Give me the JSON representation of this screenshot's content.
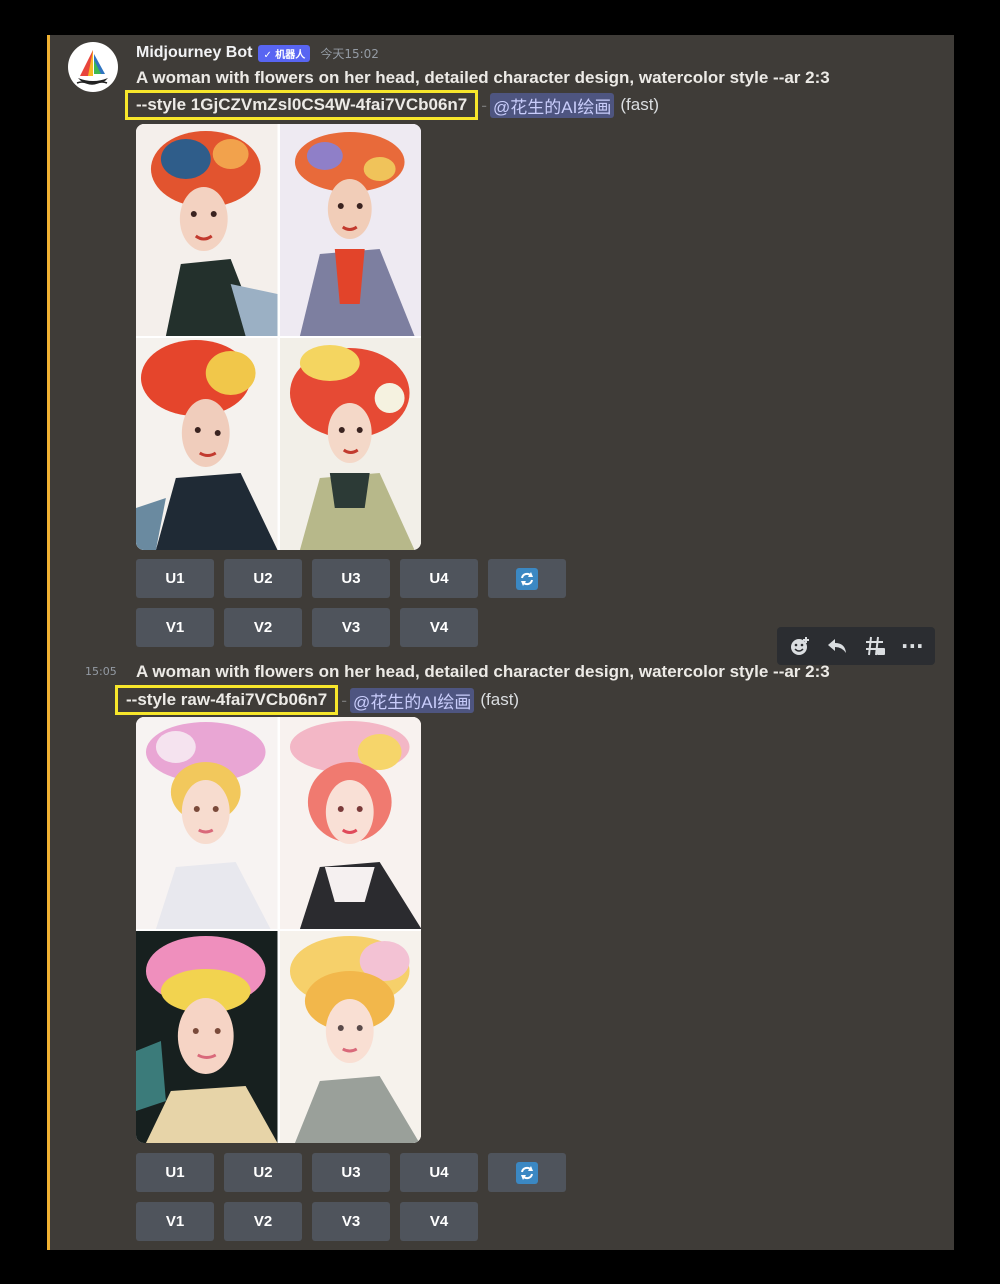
{
  "message": {
    "author": "Midjourney Bot",
    "badge": "✓ 机器人",
    "timestamp": "今天15:02"
  },
  "post1": {
    "prompt": "A woman with flowers on her head, detailed character design, watercolor style --ar 2:3",
    "style": "--style 1GjCZVmZsl0CS4W-4fai7VCb06n7",
    "separator": "-",
    "mention": "@花生的AI绘画",
    "speed": "(fast)",
    "upscale_buttons": [
      "U1",
      "U2",
      "U3",
      "U4"
    ],
    "variation_buttons": [
      "V1",
      "V2",
      "V3",
      "V4"
    ]
  },
  "post2": {
    "time": "15:05",
    "prompt": "A woman with flowers on her head, detailed character design, watercolor style --ar 2:3",
    "style": "--style raw-4fai7VCb06n7",
    "separator": "-",
    "mention": "@花生的AI绘画",
    "speed": "(fast)",
    "upscale_buttons": [
      "U1",
      "U2",
      "U3",
      "U4"
    ],
    "variation_buttons": [
      "V1",
      "V2",
      "V3",
      "V4"
    ]
  },
  "toolbar": {
    "icons": [
      "add-reaction-icon",
      "reply-icon",
      "create-thread-icon",
      "more-icon"
    ],
    "more_glyph": "···"
  },
  "colors": {
    "background": "#3f3c38",
    "accent": "#f0b132",
    "highlight_box": "#f7e62b",
    "button": "#4f545c",
    "mention_bg": "#4e5580",
    "badge": "#5865f2"
  }
}
